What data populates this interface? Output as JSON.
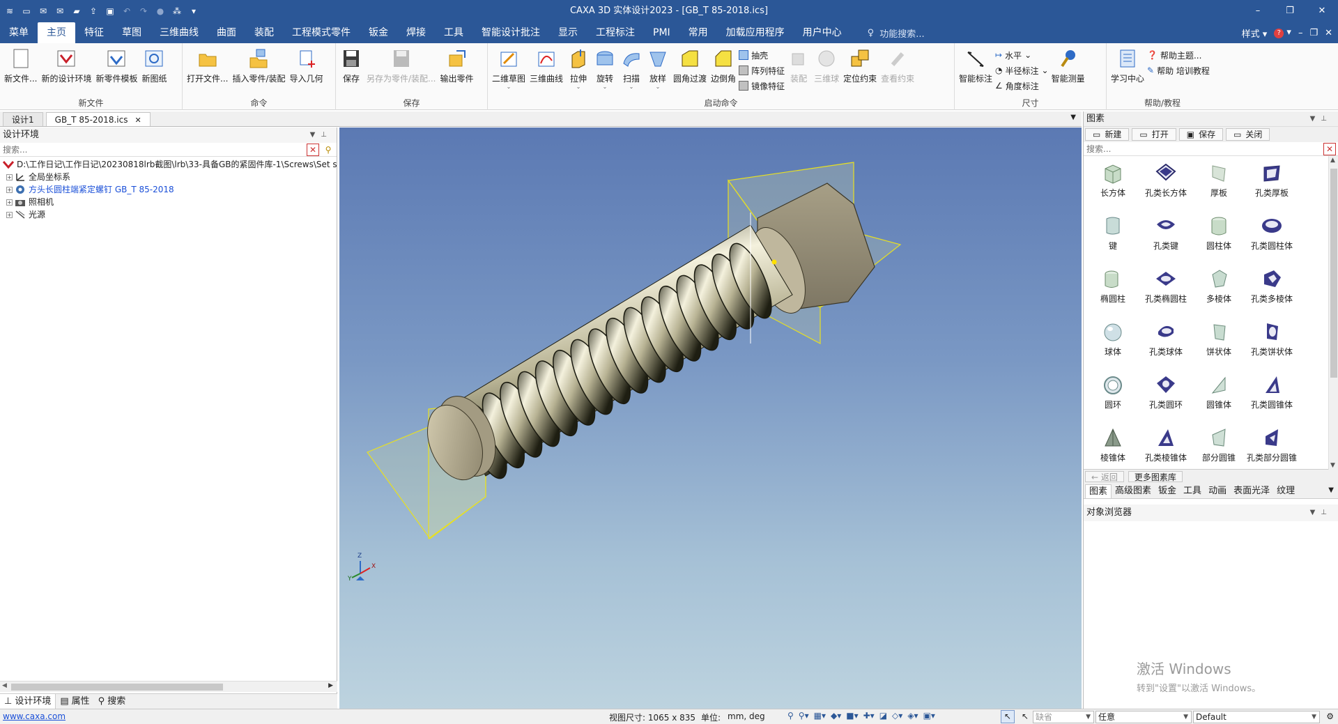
{
  "window": {
    "title": "CAXA 3D 实体设计2023 - [GB_T 85-2018.ics]",
    "controls": [
      "–",
      "❐",
      "✕"
    ]
  },
  "menu": {
    "items": [
      "菜单",
      "主页",
      "特征",
      "草图",
      "三维曲线",
      "曲面",
      "装配",
      "工程模式零件",
      "钣金",
      "焊接",
      "工具",
      "智能设计批注",
      "显示",
      "工程标注",
      "PMI",
      "常用",
      "加载应用程序",
      "用户中心"
    ],
    "active_index": 1,
    "search_placeholder": "功能搜索...",
    "style_label": "样式",
    "right_controls": [
      "–",
      "❐",
      "✕"
    ]
  },
  "ribbon": {
    "groups": [
      {
        "label": "新文件",
        "buttons": [
          "新文件...",
          "新的设计环境",
          "新零件模板",
          "新图纸"
        ]
      },
      {
        "label": "命令",
        "buttons": [
          "打开文件...",
          "插入零件/装配",
          "导入几何"
        ]
      },
      {
        "label": "保存",
        "buttons": [
          "保存",
          "另存为零件/装配...",
          "输出零件"
        ]
      },
      {
        "label": "启动命令",
        "buttons": [
          "二维草图",
          "三维曲线",
          "拉伸",
          "旋转",
          "扫描",
          "放样",
          "圆角过渡",
          "边倒角"
        ],
        "small": [
          "抽壳",
          "阵列特征",
          "镜像特征"
        ],
        "buttons2": [
          "装配",
          "三维球",
          "定位约束",
          "查看约束"
        ]
      },
      {
        "label": "尺寸",
        "buttons": [
          "智能标注"
        ],
        "small": [
          "水平",
          "半径标注",
          "角度标注"
        ],
        "buttons2": [
          "智能测量"
        ]
      },
      {
        "label": "帮助/教程",
        "buttons": [
          "学习中心"
        ],
        "small": [
          "帮助主题...",
          "帮助 培训教程"
        ]
      }
    ]
  },
  "doc_tabs": [
    "设计1",
    "GB_T 85-2018.ics"
  ],
  "left_panel": {
    "title": "设计环境",
    "search_placeholder": "搜索...",
    "tree": [
      {
        "label": "D:\\工作日记\\工作日记\\20230818lrb截图\\lrb\\33-具备GB的紧固件库-1\\Screws\\Set s",
        "icon": "root-icon"
      },
      {
        "label": "全局坐标系",
        "icon": "axis-icon"
      },
      {
        "label": "方头长圆柱端紧定螺钉 GB_T 85-2018",
        "icon": "part-icon"
      },
      {
        "label": "照相机",
        "icon": "camera-icon"
      },
      {
        "label": "光源",
        "icon": "light-icon"
      }
    ],
    "bottom_tabs": [
      "设计环境",
      "属性",
      "搜索"
    ]
  },
  "right_panel": {
    "title": "图素",
    "toolbar": [
      "新建",
      "打开",
      "保存",
      "关闭"
    ],
    "search_placeholder": "搜索...",
    "library": [
      {
        "label": "长方体",
        "shape": "box"
      },
      {
        "label": "孔类长方体",
        "shape": "holebox"
      },
      {
        "label": "厚板",
        "shape": "plate"
      },
      {
        "label": "孔类厚板",
        "shape": "holeplate"
      },
      {
        "label": "键",
        "shape": "key"
      },
      {
        "label": "孔类键",
        "shape": "holekey"
      },
      {
        "label": "圆柱体",
        "shape": "cyl"
      },
      {
        "label": "孔类圆柱体",
        "shape": "holecyl"
      },
      {
        "label": "椭圆柱",
        "shape": "ellcyl"
      },
      {
        "label": "孔类椭圆柱",
        "shape": "holeellcyl"
      },
      {
        "label": "多棱体",
        "shape": "prism"
      },
      {
        "label": "孔类多棱体",
        "shape": "holeprism"
      },
      {
        "label": "球体",
        "shape": "sphere"
      },
      {
        "label": "孔类球体",
        "shape": "holesphere"
      },
      {
        "label": "饼状体",
        "shape": "pie"
      },
      {
        "label": "孔类饼状体",
        "shape": "holepie"
      },
      {
        "label": "圆环",
        "shape": "torus"
      },
      {
        "label": "孔类圆环",
        "shape": "holetorus"
      },
      {
        "label": "圆锥体",
        "shape": "cone"
      },
      {
        "label": "孔类圆锥体",
        "shape": "holecone"
      },
      {
        "label": "棱锥体",
        "shape": "pyramid"
      },
      {
        "label": "孔类棱锥体",
        "shape": "holepyramid"
      },
      {
        "label": "部分圆锥",
        "shape": "partcone"
      },
      {
        "label": "孔类部分圆锥",
        "shape": "holepartcone"
      }
    ],
    "nav": [
      "返回",
      "更多图素库"
    ],
    "tabs": [
      "图素",
      "高级图素",
      "钣金",
      "工具",
      "动画",
      "表面光泽",
      "纹理"
    ],
    "object_browser_title": "对象浏览器",
    "watermark_line1": "激活 Windows",
    "watermark_line2": "转到\"设置\"以激活 Windows。"
  },
  "viewport": {
    "axis_labels": [
      "Z",
      "Y",
      "X"
    ]
  },
  "status": {
    "link": "www.caxa.com",
    "view_size": "视图尺寸: 1065 x  835",
    "unit_label": "单位:",
    "unit_value": "mm, deg",
    "select_default": "缺省",
    "select_any": "任意",
    "select_default2": "Default"
  }
}
